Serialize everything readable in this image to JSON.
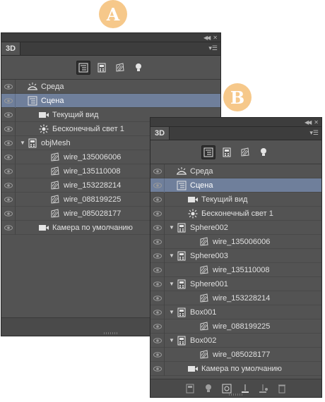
{
  "badges": {
    "a": "A",
    "b": "B"
  },
  "panel_a": {
    "tab": "3D",
    "rows": [
      {
        "label": "Среда",
        "icon": "environment-icon",
        "indent": 0,
        "twisty": false,
        "selected": false
      },
      {
        "label": "Сцена",
        "icon": "scene-icon",
        "indent": 0,
        "twisty": false,
        "selected": true
      },
      {
        "label": "Текущий вид",
        "icon": "camera-icon",
        "indent": 1,
        "twisty": false,
        "selected": false
      },
      {
        "label": "Бесконечный свет 1",
        "icon": "light-icon",
        "indent": 1,
        "twisty": false,
        "selected": false
      },
      {
        "label": "objMesh",
        "icon": "mesh-icon",
        "indent": 0,
        "twisty": true,
        "selected": false
      },
      {
        "label": "wire_135006006",
        "icon": "material-icon",
        "indent": 2,
        "twisty": false,
        "selected": false
      },
      {
        "label": "wire_135110008",
        "icon": "material-icon",
        "indent": 2,
        "twisty": false,
        "selected": false
      },
      {
        "label": "wire_153228214",
        "icon": "material-icon",
        "indent": 2,
        "twisty": false,
        "selected": false
      },
      {
        "label": "wire_088199225",
        "icon": "material-icon",
        "indent": 2,
        "twisty": false,
        "selected": false
      },
      {
        "label": "wire_085028177",
        "icon": "material-icon",
        "indent": 2,
        "twisty": false,
        "selected": false
      },
      {
        "label": "Камера по умолчанию",
        "icon": "camera-icon",
        "indent": 1,
        "twisty": false,
        "selected": false
      }
    ]
  },
  "panel_b": {
    "tab": "3D",
    "rows": [
      {
        "label": "Среда",
        "icon": "environment-icon",
        "indent": 0,
        "twisty": false,
        "selected": false
      },
      {
        "label": "Сцена",
        "icon": "scene-icon",
        "indent": 0,
        "twisty": false,
        "selected": true
      },
      {
        "label": "Текущий вид",
        "icon": "camera-icon",
        "indent": 1,
        "twisty": false,
        "selected": false
      },
      {
        "label": "Бесконечный свет 1",
        "icon": "light-icon",
        "indent": 1,
        "twisty": false,
        "selected": false
      },
      {
        "label": "Sphere002",
        "icon": "mesh-icon",
        "indent": 0,
        "twisty": true,
        "selected": false
      },
      {
        "label": "wire_135006006",
        "icon": "material-icon",
        "indent": 2,
        "twisty": false,
        "selected": false
      },
      {
        "label": "Sphere003",
        "icon": "mesh-icon",
        "indent": 0,
        "twisty": true,
        "selected": false
      },
      {
        "label": "wire_135110008",
        "icon": "material-icon",
        "indent": 2,
        "twisty": false,
        "selected": false
      },
      {
        "label": "Sphere001",
        "icon": "mesh-icon",
        "indent": 0,
        "twisty": true,
        "selected": false
      },
      {
        "label": "wire_153228214",
        "icon": "material-icon",
        "indent": 2,
        "twisty": false,
        "selected": false
      },
      {
        "label": "Box001",
        "icon": "mesh-icon",
        "indent": 0,
        "twisty": true,
        "selected": false
      },
      {
        "label": "wire_088199225",
        "icon": "material-icon",
        "indent": 2,
        "twisty": false,
        "selected": false
      },
      {
        "label": "Box002",
        "icon": "mesh-icon",
        "indent": 0,
        "twisty": true,
        "selected": false
      },
      {
        "label": "wire_085028177",
        "icon": "material-icon",
        "indent": 2,
        "twisty": false,
        "selected": false
      },
      {
        "label": "Камера по умолчанию",
        "icon": "camera-icon",
        "indent": 1,
        "twisty": false,
        "selected": false
      }
    ]
  },
  "colors": {
    "panel_bg": "#535353",
    "selected_row": "#6f7f9b",
    "badge": "#f6c88a"
  }
}
